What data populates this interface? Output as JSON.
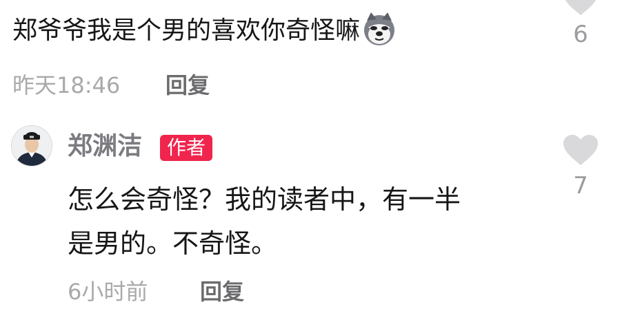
{
  "comment1": {
    "text": "郑爷爷我是个男的喜欢你奇怪嘛",
    "emoji": "husky-emoji",
    "time": "昨天18:46",
    "reply_label": "回复",
    "likes": "6"
  },
  "comment2": {
    "author": "郑渊洁",
    "badge": "作者",
    "line1": "怎么会奇怪？我的读者中，有一半",
    "line2": "是男的。不奇怪。",
    "time": "6小时前",
    "reply_label": "回复",
    "likes": "7"
  },
  "colors": {
    "badge": "#f0254d",
    "heart": "#d9d9db",
    "meta": "#a9a9ab"
  }
}
